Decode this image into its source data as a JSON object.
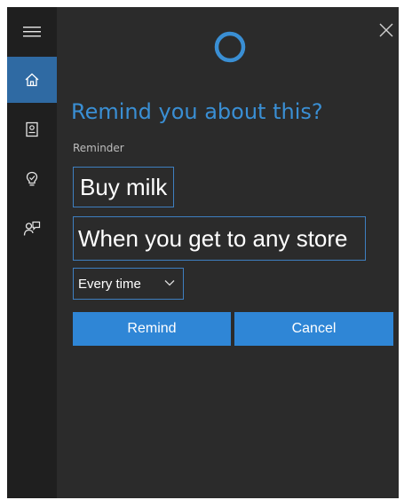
{
  "title": "Remind you about this?",
  "reminder_label": "Reminder",
  "reminder_value": "Buy milk",
  "trigger_value": "When you get to any store",
  "frequency": {
    "selected": "Every time"
  },
  "buttons": {
    "remind": "Remind",
    "cancel": "Cancel"
  },
  "sidebar": {
    "items": [
      {
        "icon": "hamburger-menu-icon"
      },
      {
        "icon": "home-icon",
        "active": true
      },
      {
        "icon": "notebook-icon"
      },
      {
        "icon": "lightbulb-icon"
      },
      {
        "icon": "feedback-icon"
      }
    ]
  },
  "colors": {
    "accent": "#2f86d6",
    "title": "#3a8fd4",
    "active_nav": "#2f6aa3",
    "background": "#2b2b2b",
    "sidebar": "#1f1f1f"
  }
}
